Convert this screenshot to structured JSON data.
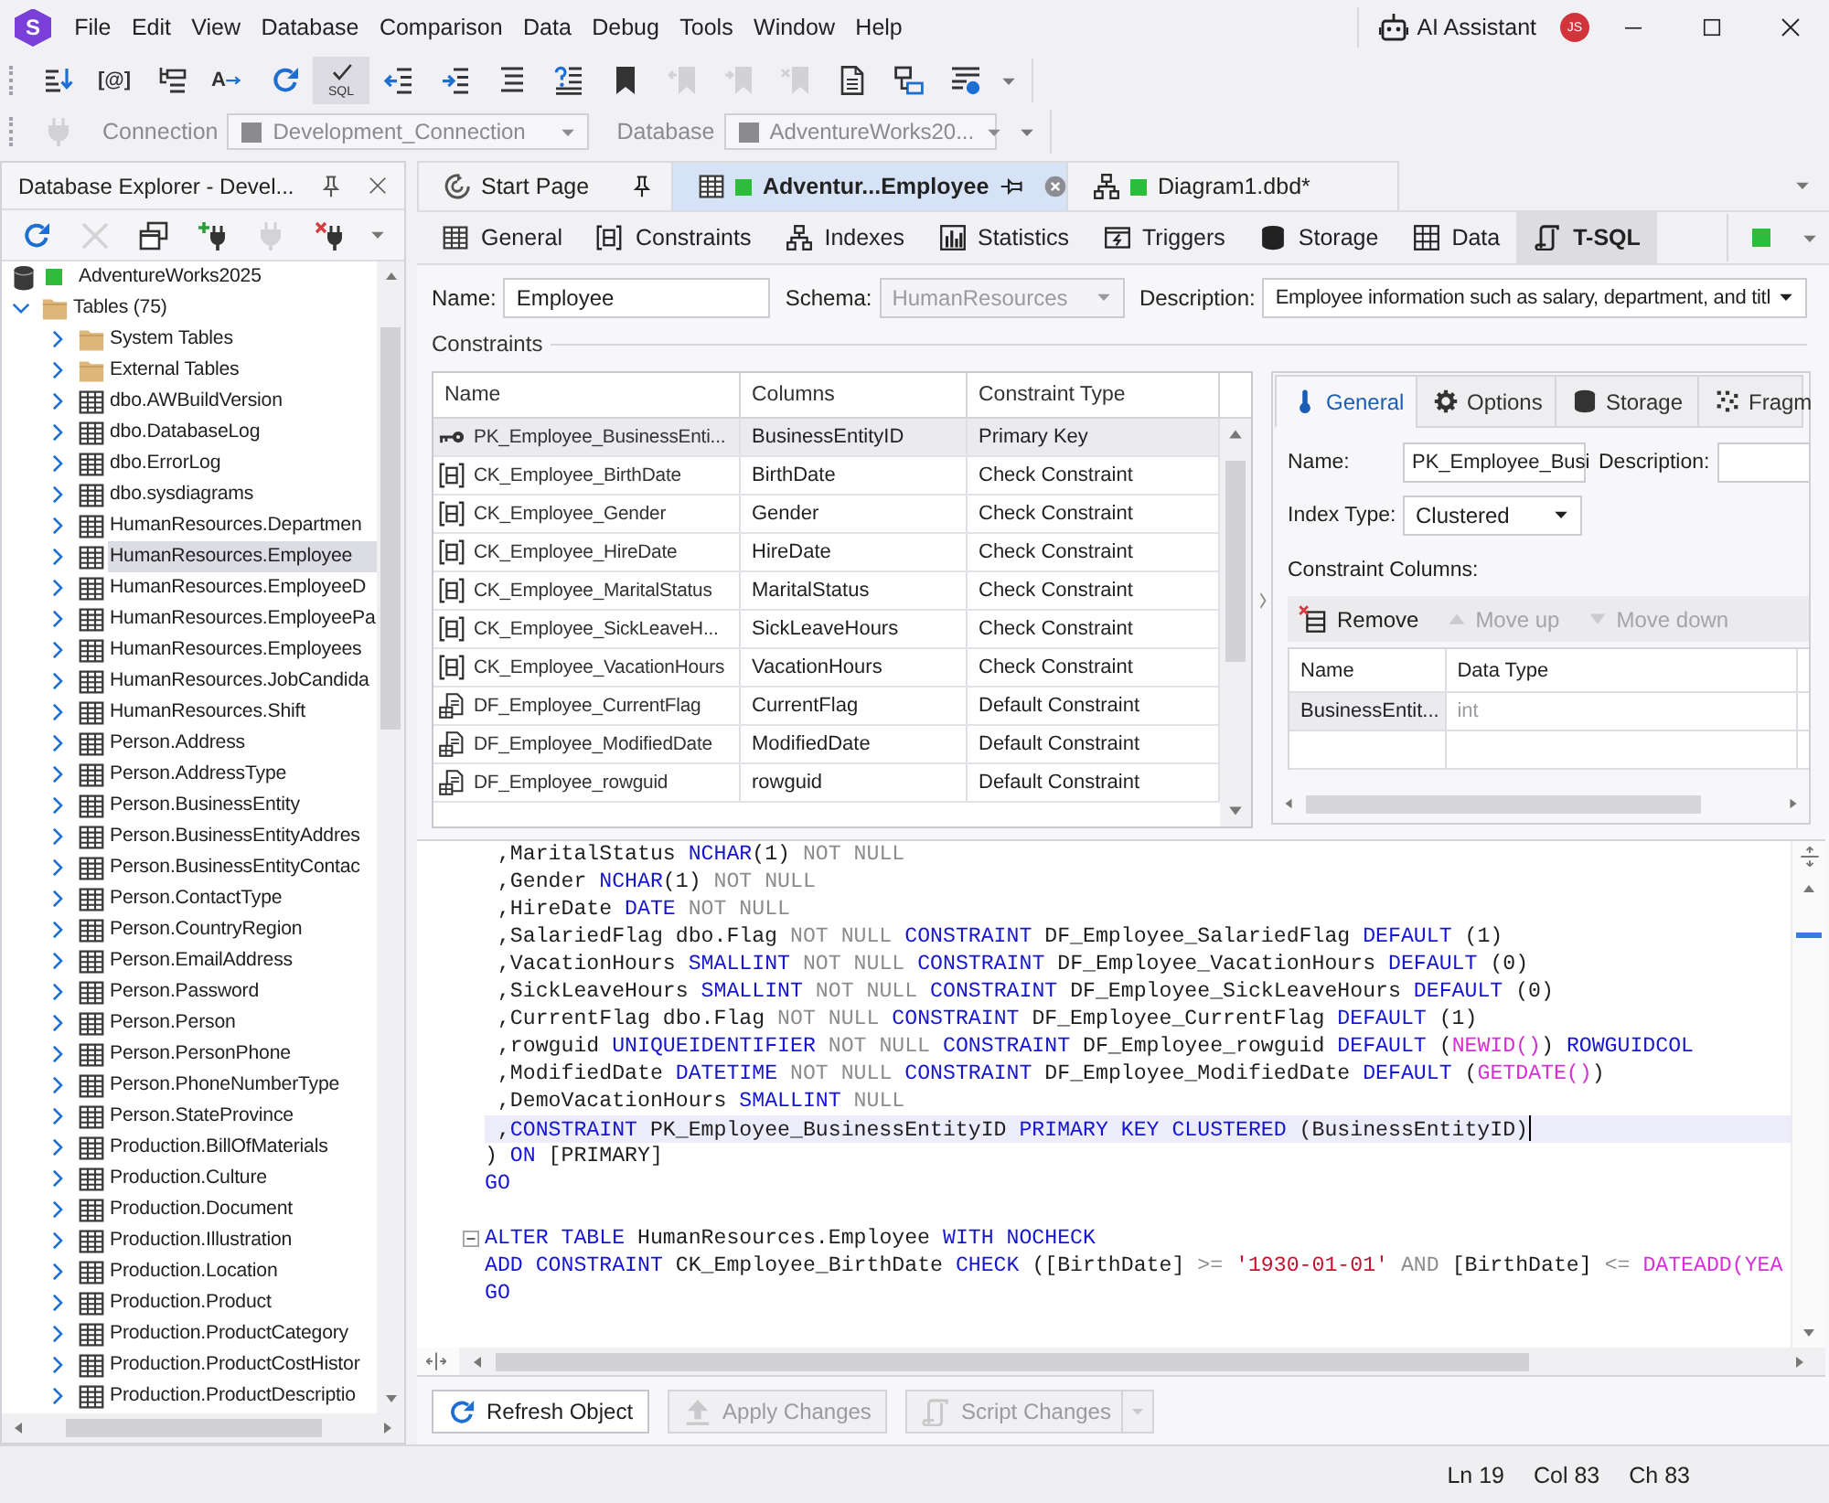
{
  "title_bar": {
    "logo": "S",
    "menu": [
      "File",
      "Edit",
      "View",
      "Database",
      "Comparison",
      "Data",
      "Debug",
      "Tools",
      "Window",
      "Help"
    ],
    "assistant": "AI Assistant",
    "avatar": "JS"
  },
  "toolbar": {
    "buttons": [
      {
        "kind": "listdown",
        "pressed": false,
        "disabled": false
      },
      {
        "kind": "variable",
        "caption": "[@]",
        "pressed": false,
        "disabled": false
      },
      {
        "kind": "indentlist",
        "pressed": false,
        "disabled": false
      },
      {
        "kind": "case",
        "caption": "A",
        "pressed": false,
        "disabled": false
      },
      {
        "kind": "refresh",
        "pressed": false,
        "disabled": false
      },
      {
        "kind": "check",
        "caption": "SQL",
        "pressed": true,
        "disabled": false
      },
      {
        "kind": "outdent",
        "pressed": false,
        "disabled": false
      },
      {
        "kind": "indent",
        "pressed": false,
        "disabled": false
      },
      {
        "kind": "lines",
        "pressed": false,
        "disabled": false
      },
      {
        "kind": "help",
        "pressed": false,
        "disabled": false
      },
      {
        "kind": "bookmark",
        "pressed": false,
        "disabled": false
      },
      {
        "kind": "prevmark",
        "pressed": false,
        "disabled": true
      },
      {
        "kind": "nextmark",
        "pressed": false,
        "disabled": true
      },
      {
        "kind": "clearmark",
        "pressed": false,
        "disabled": true
      },
      {
        "kind": "document",
        "pressed": false,
        "disabled": false
      },
      {
        "kind": "link",
        "pressed": false,
        "disabled": false
      },
      {
        "kind": "filter",
        "pressed": false,
        "disabled": false
      }
    ]
  },
  "connection_bar": {
    "disabled": true,
    "connection_label": "Connection",
    "connection": "Development_Connection",
    "database_label": "Database",
    "database": "AdventureWorks20..."
  },
  "explorer": {
    "title": "Database Explorer - Devel...",
    "toolbar": [
      {
        "kind": "refresh",
        "disabled": false
      },
      {
        "kind": "delete",
        "disabled": true
      },
      {
        "kind": "windows",
        "disabled": false
      },
      {
        "kind": "connect",
        "disabled": false
      },
      {
        "kind": "plug",
        "disabled": true
      },
      {
        "kind": "disconnect",
        "disabled": false
      }
    ],
    "tree": [
      {
        "label": "AdventureWorks2025",
        "kind": "database",
        "color": "#2ebd3a",
        "selected": false,
        "children": [
          {
            "label": "Tables (75)",
            "kind": "folder",
            "expanded": true,
            "selected": false,
            "children": [
              {
                "label": "System Tables",
                "kind": "folder",
                "expanded": false,
                "selected": false
              },
              {
                "label": "External Tables",
                "kind": "folder",
                "expanded": false,
                "selected": false
              },
              {
                "label": "dbo.AWBuildVersion",
                "kind": "table",
                "expanded": false,
                "selected": false
              },
              {
                "label": "dbo.DatabaseLog",
                "kind": "table",
                "expanded": false,
                "selected": false
              },
              {
                "label": "dbo.ErrorLog",
                "kind": "table",
                "expanded": false,
                "selected": false
              },
              {
                "label": "dbo.sysdiagrams",
                "kind": "table",
                "expanded": false,
                "selected": false
              },
              {
                "label": "HumanResources.Departmen",
                "kind": "table",
                "expanded": false,
                "selected": false
              },
              {
                "label": "HumanResources.Employee",
                "kind": "table",
                "expanded": false,
                "selected": true
              },
              {
                "label": "HumanResources.EmployeeD",
                "kind": "table",
                "expanded": false,
                "selected": false
              },
              {
                "label": "HumanResources.EmployeePa",
                "kind": "table",
                "expanded": false,
                "selected": false
              },
              {
                "label": "HumanResources.Employees",
                "kind": "table",
                "expanded": false,
                "selected": false
              },
              {
                "label": "HumanResources.JobCandida",
                "kind": "table",
                "expanded": false,
                "selected": false
              },
              {
                "label": "HumanResources.Shift",
                "kind": "table",
                "expanded": false,
                "selected": false
              },
              {
                "label": "Person.Address",
                "kind": "table",
                "expanded": false,
                "selected": false
              },
              {
                "label": "Person.AddressType",
                "kind": "table",
                "expanded": false,
                "selected": false
              },
              {
                "label": "Person.BusinessEntity",
                "kind": "table",
                "expanded": false,
                "selected": false
              },
              {
                "label": "Person.BusinessEntityAddres",
                "kind": "table",
                "expanded": false,
                "selected": false
              },
              {
                "label": "Person.BusinessEntityContac",
                "kind": "table",
                "expanded": false,
                "selected": false
              },
              {
                "label": "Person.ContactType",
                "kind": "table",
                "expanded": false,
                "selected": false
              },
              {
                "label": "Person.CountryRegion",
                "kind": "table",
                "expanded": false,
                "selected": false
              },
              {
                "label": "Person.EmailAddress",
                "kind": "table",
                "expanded": false,
                "selected": false
              },
              {
                "label": "Person.Password",
                "kind": "table",
                "expanded": false,
                "selected": false
              },
              {
                "label": "Person.Person",
                "kind": "table",
                "expanded": false,
                "selected": false
              },
              {
                "label": "Person.PersonPhone",
                "kind": "table",
                "expanded": false,
                "selected": false
              },
              {
                "label": "Person.PhoneNumberType",
                "kind": "table",
                "expanded": false,
                "selected": false
              },
              {
                "label": "Person.StateProvince",
                "kind": "table",
                "expanded": false,
                "selected": false
              },
              {
                "label": "Production.BillOfMaterials",
                "kind": "table",
                "expanded": false,
                "selected": false
              },
              {
                "label": "Production.Culture",
                "kind": "table",
                "expanded": false,
                "selected": false
              },
              {
                "label": "Production.Document",
                "kind": "table",
                "expanded": false,
                "selected": false
              },
              {
                "label": "Production.Illustration",
                "kind": "table",
                "expanded": false,
                "selected": false
              },
              {
                "label": "Production.Location",
                "kind": "table",
                "expanded": false,
                "selected": false
              },
              {
                "label": "Production.Product",
                "kind": "table",
                "expanded": false,
                "selected": false
              },
              {
                "label": "Production.ProductCategory",
                "kind": "table",
                "expanded": false,
                "selected": false
              },
              {
                "label": "Production.ProductCostHistor",
                "kind": "table",
                "expanded": false,
                "selected": false
              },
              {
                "label": "Production.ProductDescriptio",
                "kind": "table",
                "expanded": false,
                "selected": false
              }
            ]
          }
        ]
      }
    ]
  },
  "document_tabs": [
    {
      "label": "Start Page",
      "kind": "start",
      "selected": false
    },
    {
      "label": "Adventur...Employee",
      "kind": "table",
      "color": "#2ebd3a",
      "selected": true
    },
    {
      "label": "Diagram1.dbd*",
      "kind": "diagram",
      "color": "#2ebd3a",
      "selected": false
    }
  ],
  "editor_tabs": [
    {
      "label": "General",
      "kind": "general",
      "selected": false
    },
    {
      "label": "Constraints",
      "kind": "constraints",
      "selected": false
    },
    {
      "label": "Indexes",
      "kind": "indexes",
      "selected": false
    },
    {
      "label": "Statistics",
      "kind": "statistics",
      "selected": false
    },
    {
      "label": "Triggers",
      "kind": "triggers",
      "selected": false
    },
    {
      "label": "Storage",
      "kind": "storage",
      "selected": false
    },
    {
      "label": "Data",
      "kind": "data",
      "selected": false
    },
    {
      "label": "T-SQL",
      "kind": "tsql",
      "selected": true
    }
  ],
  "table_form": {
    "name_label": "Name:",
    "name": "Employee",
    "schema_label": "Schema:",
    "schema": "HumanResources",
    "schema_disabled": true,
    "description_label": "Description:",
    "description": "Employee information such as salary, department, and titl"
  },
  "constraints": {
    "title": "Constraints",
    "columns": [
      "Name",
      "Columns",
      "Constraint Type"
    ],
    "rows": [
      {
        "kind": "primary",
        "name": "PK_Employee_BusinessEnti...",
        "columns": "BusinessEntityID",
        "type": "Primary Key",
        "selected": true
      },
      {
        "kind": "check",
        "name": "CK_Employee_BirthDate",
        "columns": "BirthDate",
        "type": "Check Constraint",
        "selected": false
      },
      {
        "kind": "check",
        "name": "CK_Employee_Gender",
        "columns": "Gender",
        "type": "Check Constraint",
        "selected": false
      },
      {
        "kind": "check",
        "name": "CK_Employee_HireDate",
        "columns": "HireDate",
        "type": "Check Constraint",
        "selected": false
      },
      {
        "kind": "check",
        "name": "CK_Employee_MaritalStatus",
        "columns": "MaritalStatus",
        "type": "Check Constraint",
        "selected": false
      },
      {
        "kind": "check",
        "name": "CK_Employee_SickLeaveH...",
        "columns": "SickLeaveHours",
        "type": "Check Constraint",
        "selected": false
      },
      {
        "kind": "check",
        "name": "CK_Employee_VacationHours",
        "columns": "VacationHours",
        "type": "Check Constraint",
        "selected": false
      },
      {
        "kind": "default",
        "name": "DF_Employee_CurrentFlag",
        "columns": "CurrentFlag",
        "type": "Default Constraint",
        "selected": false
      },
      {
        "kind": "default",
        "name": "DF_Employee_ModifiedDate",
        "columns": "ModifiedDate",
        "type": "Default Constraint",
        "selected": false
      },
      {
        "kind": "default",
        "name": "DF_Employee_rowguid",
        "columns": "rowguid",
        "type": "Default Constraint",
        "selected": false
      }
    ]
  },
  "properties": {
    "tabs": [
      {
        "label": "General",
        "kind": "general",
        "selected": true
      },
      {
        "label": "Options",
        "kind": "options",
        "selected": false
      },
      {
        "label": "Storage",
        "kind": "storage",
        "selected": false
      },
      {
        "label": "Fragm",
        "kind": "fragmentation",
        "selected": false
      }
    ],
    "name_label": "Name:",
    "name": "PK_Employee_Busi",
    "description_label": "Description:",
    "index_type_label": "Index Type:",
    "index_type": "Clustered",
    "columns_label": "Constraint Columns:",
    "actions": [
      {
        "label": "Remove",
        "kind": "remove",
        "disabled": false
      },
      {
        "label": "Move up",
        "kind": "up",
        "disabled": true
      },
      {
        "label": "Move down",
        "kind": "down",
        "disabled": true
      }
    ],
    "grid": {
      "columns": [
        "Name",
        "Data Type"
      ],
      "rows": [
        {
          "name": "BusinessEntit...",
          "type": "int",
          "selected": true
        }
      ]
    }
  },
  "sql": {
    "lines": [
      {
        "current": false,
        "fold": false,
        "tokens": [
          {
            "text": " ,MaritalStatus ",
            "kind": "plain"
          },
          {
            "text": "NCHAR",
            "kind": "keyword"
          },
          {
            "text": "(1) ",
            "kind": "plain"
          },
          {
            "text": "NOT NULL",
            "kind": "muted"
          }
        ]
      },
      {
        "current": false,
        "fold": false,
        "tokens": [
          {
            "text": " ,Gender ",
            "kind": "plain"
          },
          {
            "text": "NCHAR",
            "kind": "keyword"
          },
          {
            "text": "(1) ",
            "kind": "plain"
          },
          {
            "text": "NOT NULL",
            "kind": "muted"
          }
        ]
      },
      {
        "current": false,
        "fold": false,
        "tokens": [
          {
            "text": " ,HireDate ",
            "kind": "plain"
          },
          {
            "text": "DATE ",
            "kind": "keyword"
          },
          {
            "text": "NOT NULL",
            "kind": "muted"
          }
        ]
      },
      {
        "current": false,
        "fold": false,
        "tokens": [
          {
            "text": " ,SalariedFlag dbo.Flag ",
            "kind": "plain"
          },
          {
            "text": "NOT NULL ",
            "kind": "muted"
          },
          {
            "text": "CONSTRAINT ",
            "kind": "keyword"
          },
          {
            "text": "DF_Employee_SalariedFlag ",
            "kind": "plain"
          },
          {
            "text": "DEFAULT ",
            "kind": "keyword"
          },
          {
            "text": "(1)",
            "kind": "plain"
          }
        ]
      },
      {
        "current": false,
        "fold": false,
        "tokens": [
          {
            "text": " ,VacationHours ",
            "kind": "plain"
          },
          {
            "text": "SMALLINT ",
            "kind": "keyword"
          },
          {
            "text": "NOT NULL ",
            "kind": "muted"
          },
          {
            "text": "CONSTRAINT ",
            "kind": "keyword"
          },
          {
            "text": "DF_Employee_VacationHours ",
            "kind": "plain"
          },
          {
            "text": "DEFAULT ",
            "kind": "keyword"
          },
          {
            "text": "(0)",
            "kind": "plain"
          }
        ]
      },
      {
        "current": false,
        "fold": false,
        "tokens": [
          {
            "text": " ,SickLeaveHours ",
            "kind": "plain"
          },
          {
            "text": "SMALLINT ",
            "kind": "keyword"
          },
          {
            "text": "NOT NULL ",
            "kind": "muted"
          },
          {
            "text": "CONSTRAINT ",
            "kind": "keyword"
          },
          {
            "text": "DF_Employee_SickLeaveHours ",
            "kind": "plain"
          },
          {
            "text": "DEFAULT ",
            "kind": "keyword"
          },
          {
            "text": "(0)",
            "kind": "plain"
          }
        ]
      },
      {
        "current": false,
        "fold": false,
        "tokens": [
          {
            "text": " ,CurrentFlag dbo.Flag ",
            "kind": "plain"
          },
          {
            "text": "NOT NULL ",
            "kind": "muted"
          },
          {
            "text": "CONSTRAINT ",
            "kind": "keyword"
          },
          {
            "text": "DF_Employee_CurrentFlag ",
            "kind": "plain"
          },
          {
            "text": "DEFAULT ",
            "kind": "keyword"
          },
          {
            "text": "(1)",
            "kind": "plain"
          }
        ]
      },
      {
        "current": false,
        "fold": false,
        "tokens": [
          {
            "text": " ,rowguid ",
            "kind": "plain"
          },
          {
            "text": "UNIQUEIDENTIFIER ",
            "kind": "keyword"
          },
          {
            "text": "NOT NULL ",
            "kind": "muted"
          },
          {
            "text": "CONSTRAINT ",
            "kind": "keyword"
          },
          {
            "text": "DF_Employee_rowguid ",
            "kind": "plain"
          },
          {
            "text": "DEFAULT ",
            "kind": "keyword"
          },
          {
            "text": "(",
            "kind": "plain"
          },
          {
            "text": "NEWID()",
            "kind": "function"
          },
          {
            "text": ") ",
            "kind": "plain"
          },
          {
            "text": "ROWGUIDCOL",
            "kind": "keyword"
          }
        ]
      },
      {
        "current": false,
        "fold": false,
        "tokens": [
          {
            "text": " ,ModifiedDate ",
            "kind": "plain"
          },
          {
            "text": "DATETIME ",
            "kind": "keyword"
          },
          {
            "text": "NOT NULL ",
            "kind": "muted"
          },
          {
            "text": "CONSTRAINT ",
            "kind": "keyword"
          },
          {
            "text": "DF_Employee_ModifiedDate ",
            "kind": "plain"
          },
          {
            "text": "DEFAULT ",
            "kind": "keyword"
          },
          {
            "text": "(",
            "kind": "plain"
          },
          {
            "text": "GETDATE()",
            "kind": "function"
          },
          {
            "text": ")",
            "kind": "plain"
          }
        ]
      },
      {
        "current": false,
        "fold": false,
        "tokens": [
          {
            "text": " ,DemoVacationHours ",
            "kind": "plain"
          },
          {
            "text": "SMALLINT ",
            "kind": "keyword"
          },
          {
            "text": "NULL",
            "kind": "muted"
          }
        ]
      },
      {
        "current": true,
        "fold": false,
        "tokens": [
          {
            "text": " ,",
            "kind": "plain"
          },
          {
            "text": "CONSTRAINT ",
            "kind": "keyword"
          },
          {
            "text": "PK_Employee_BusinessEntityID ",
            "kind": "plain"
          },
          {
            "text": "PRIMARY KEY CLUSTERED ",
            "kind": "keyword"
          },
          {
            "text": "(BusinessEntityID)",
            "kind": "plain"
          }
        ]
      },
      {
        "current": false,
        "fold": false,
        "tokens": [
          {
            "text": ") ",
            "kind": "plain"
          },
          {
            "text": "ON ",
            "kind": "keyword"
          },
          {
            "text": "[PRIMARY]",
            "kind": "plain"
          }
        ]
      },
      {
        "current": false,
        "fold": false,
        "tokens": [
          {
            "text": "GO",
            "kind": "keyword"
          }
        ]
      },
      {
        "current": false,
        "fold": false
      },
      {
        "current": false,
        "fold": true,
        "tokens": [
          {
            "text": "ALTER TABLE ",
            "kind": "keyword"
          },
          {
            "text": "HumanResources.Employee ",
            "kind": "plain"
          },
          {
            "text": "WITH NOCHECK",
            "kind": "keyword"
          }
        ]
      },
      {
        "current": false,
        "fold": false,
        "tokens": [
          {
            "text": "ADD CONSTRAINT ",
            "kind": "keyword"
          },
          {
            "text": "CK_Employee_BirthDate ",
            "kind": "plain"
          },
          {
            "text": "CHECK ",
            "kind": "keyword"
          },
          {
            "text": "([BirthDate] ",
            "kind": "plain"
          },
          {
            "text": ">= ",
            "kind": "muted"
          },
          {
            "text": "'1930-01-01'",
            "kind": "string"
          },
          {
            "text": " AND ",
            "kind": "muted"
          },
          {
            "text": "[BirthDate] ",
            "kind": "plain"
          },
          {
            "text": "<= ",
            "kind": "muted"
          },
          {
            "text": "DATEADD(YEA",
            "kind": "function"
          }
        ]
      },
      {
        "current": false,
        "fold": false,
        "tokens": [
          {
            "text": "GO",
            "kind": "keyword"
          }
        ]
      }
    ]
  },
  "actions": [
    {
      "label": "Refresh Object",
      "kind": "refresh",
      "disabled": false,
      "menu": false
    },
    {
      "label": "Apply Changes",
      "kind": "apply",
      "disabled": true,
      "menu": false
    },
    {
      "label": "Script Changes",
      "kind": "script",
      "disabled": true,
      "menu": true
    }
  ],
  "status_bar": {
    "line": "Ln 19",
    "column": "Col 83",
    "char": "Ch 83"
  }
}
